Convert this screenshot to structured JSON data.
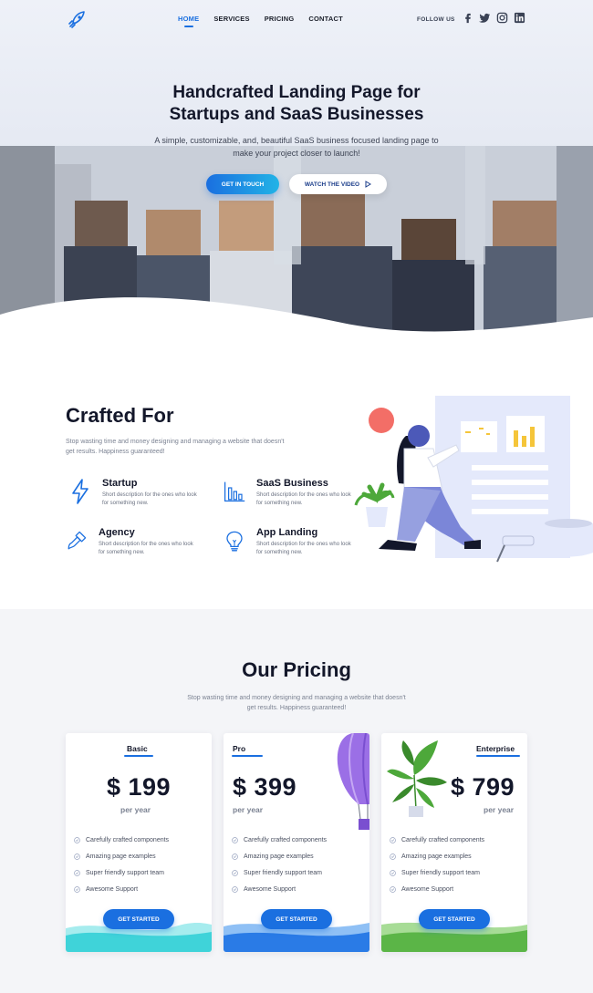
{
  "nav": {
    "links": [
      {
        "label": "HOME",
        "active": true
      },
      {
        "label": "SERVICES",
        "active": false
      },
      {
        "label": "PRICING",
        "active": false
      },
      {
        "label": "CONTACT",
        "active": false
      }
    ],
    "follow_label": "FOLLOW US",
    "socials": [
      "facebook-icon",
      "twitter-icon",
      "instagram-icon",
      "linkedin-icon"
    ]
  },
  "hero": {
    "title_line1": "Handcrafted Landing Page for",
    "title_line2": "Startups and SaaS Businesses",
    "subtitle": "A simple, customizable, and, beautiful SaaS business focused landing page to make your project closer to launch!",
    "primary_button": "GET IN TOUCH",
    "video_button": "WATCH THE VIDEO"
  },
  "crafted": {
    "title": "Crafted For",
    "description": "Stop wasting time and money designing and managing a website that doesn't get results. Happiness guaranteed!",
    "features": [
      {
        "title": "Startup",
        "description": "Short description for the ones who look for something new.",
        "icon": "lightning-icon"
      },
      {
        "title": "SaaS Business",
        "description": "Short description for the ones who look for something new.",
        "icon": "bar-chart-icon"
      },
      {
        "title": "Agency",
        "description": "Short description for the ones who look for something new.",
        "icon": "paint-brush-icon"
      },
      {
        "title": "App Landing",
        "description": "Short description for the ones who look for something new.",
        "icon": "lightbulb-icon"
      }
    ]
  },
  "pricing": {
    "title": "Our Pricing",
    "description": "Stop wasting time and money designing and managing a website that doesn't get results. Happiness guaranteed!",
    "plans": [
      {
        "name": "Basic",
        "price": "$ 199",
        "period": "per year",
        "button": "GET STARTED",
        "accent": "#3fd3d9",
        "features": [
          "Carefully crafted components",
          "Amazing page examples",
          "Super friendly support team",
          "Awesome Support"
        ]
      },
      {
        "name": "Pro",
        "price": "$ 399",
        "period": "per year",
        "button": "GET STARTED",
        "accent": "#2a7be6",
        "features": [
          "Carefully crafted components",
          "Amazing page examples",
          "Super friendly support team",
          "Awesome Support"
        ]
      },
      {
        "name": "Enterprise",
        "price": "$ 799",
        "period": "per year",
        "button": "GET STARTED",
        "accent": "#5bb547",
        "features": [
          "Carefully crafted components",
          "Amazing page examples",
          "Super friendly support team",
          "Awesome Support"
        ]
      }
    ]
  },
  "colors": {
    "primary": "#1a6fe0",
    "heading": "#13172a",
    "muted": "#7b8292"
  }
}
